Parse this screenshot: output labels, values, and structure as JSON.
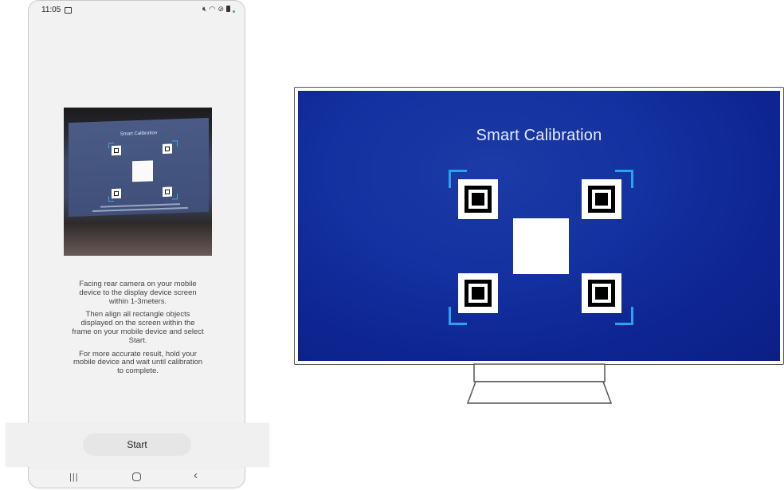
{
  "phone": {
    "status_bar": {
      "time": "11:05",
      "icons": [
        "photo-icon",
        "mute-icon",
        "wifi-icon",
        "do-not-disturb-icon",
        "battery-icon"
      ]
    },
    "camera_preview": {
      "screen_title": "Smart Calibration"
    },
    "instructions": [
      "Facing rear camera on your mobile device to the display device screen within 1-3meters.",
      "Then align all rectangle objects displayed on the screen within the frame on your mobile device and select Start.",
      "For more accurate result, hold your mobile device and wait until calibration to complete."
    ],
    "start_label": "Start",
    "nav_bar": {
      "recents_glyph": "|||",
      "back_glyph": "‹"
    }
  },
  "tv": {
    "title": "Smart Calibration",
    "colors": {
      "screen_background": "#1331a0",
      "bracket_accent": "#27a4ef",
      "marker": "#ffffff"
    }
  }
}
